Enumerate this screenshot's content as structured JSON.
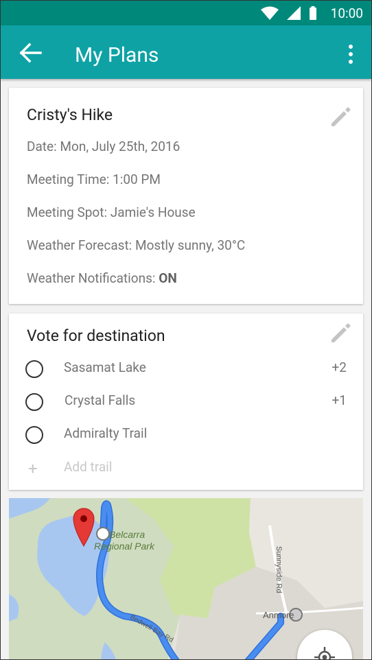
{
  "status_bar": {
    "time": "10:00"
  },
  "app_bar": {
    "title": "My Plans"
  },
  "plan_card": {
    "title": "Cristy's Hike",
    "date": "Date: Mon, July 25th, 2016",
    "meeting_time": "Meeting Time: 1:00 PM",
    "meeting_spot": "Meeting Spot: Jamie's House",
    "weather_forecast": "Weather Forecast: Mostly sunny, 30°C",
    "weather_notifications_label": "Weather Notifications: ",
    "weather_notifications_value": "ON"
  },
  "vote_card": {
    "title": "Vote for destination",
    "options": [
      {
        "label": "Sasamat Lake",
        "votes": "+2"
      },
      {
        "label": "Crystal Falls",
        "votes": "+1"
      },
      {
        "label": "Admiralty Trail",
        "votes": ""
      }
    ],
    "add_placeholder": "Add trail"
  },
  "map": {
    "park_label_line1": "Belcarra",
    "park_label_line2": "Regional Park",
    "road1": "Bedwell Bay Rd",
    "road2": "Sunnyside Rd",
    "place": "Anmore"
  },
  "colors": {
    "status_bar": "#00897b",
    "app_bar": "#0ea2a5",
    "route": "#4a8df0",
    "pin": "#e53935"
  }
}
